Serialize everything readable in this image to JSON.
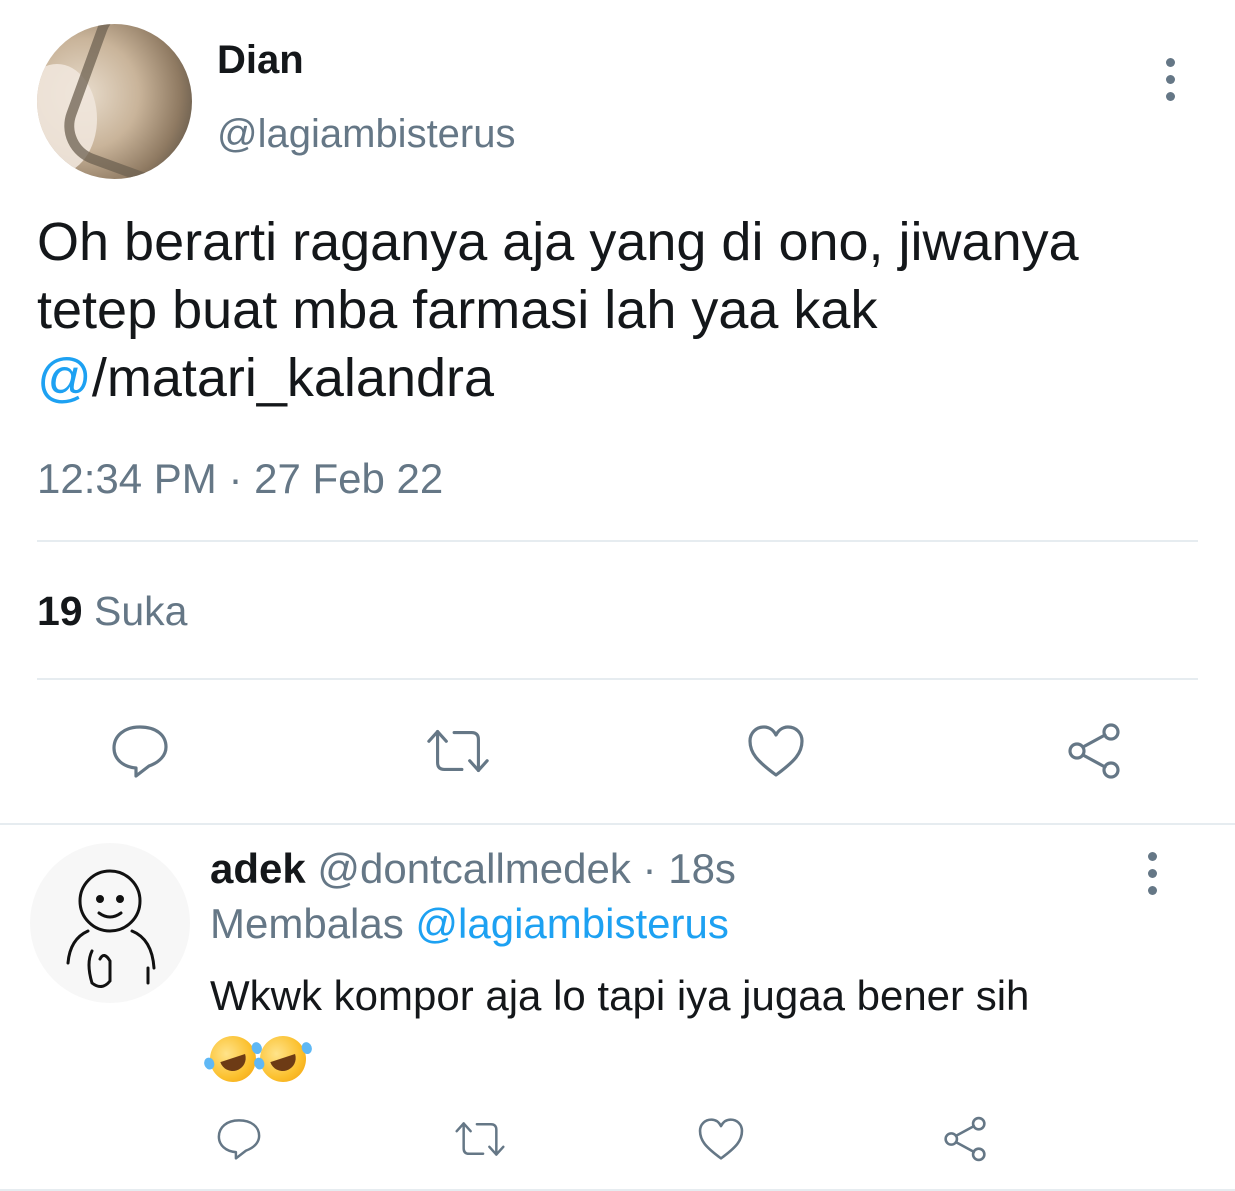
{
  "tweet": {
    "author_name": "Dian",
    "author_handle": "@lagiambisterus",
    "body_line1": "Oh berarti raganya aja yang di ono, jiwanya",
    "body_line2": "tetep buat mba farmasi lah yaa kak",
    "mention_at": "@",
    "mention_rest": "/matari_kalandra",
    "time": "12:34 PM",
    "dot": "·",
    "date": "27 Feb 22",
    "like_count": "19",
    "like_label": "Suka"
  },
  "reply": {
    "author_name": "adek",
    "author_handle": "@dontcallmedek",
    "dot": "·",
    "age": "18s",
    "replying_label": "Membalas",
    "replying_to": "@lagiambisterus",
    "body": "Wkwk kompor aja lo tapi iya jugaa bener sih",
    "emojis": [
      "rolling-on-floor-laughing-emoji",
      "rolling-on-floor-laughing-emoji"
    ]
  },
  "colors": {
    "text": "#14171a",
    "muted": "#657786",
    "accent": "#1da1f2",
    "divider": "#e6ecf0"
  },
  "icons": [
    "reply-icon",
    "retweet-icon",
    "like-icon",
    "share-icon",
    "more-icon"
  ]
}
